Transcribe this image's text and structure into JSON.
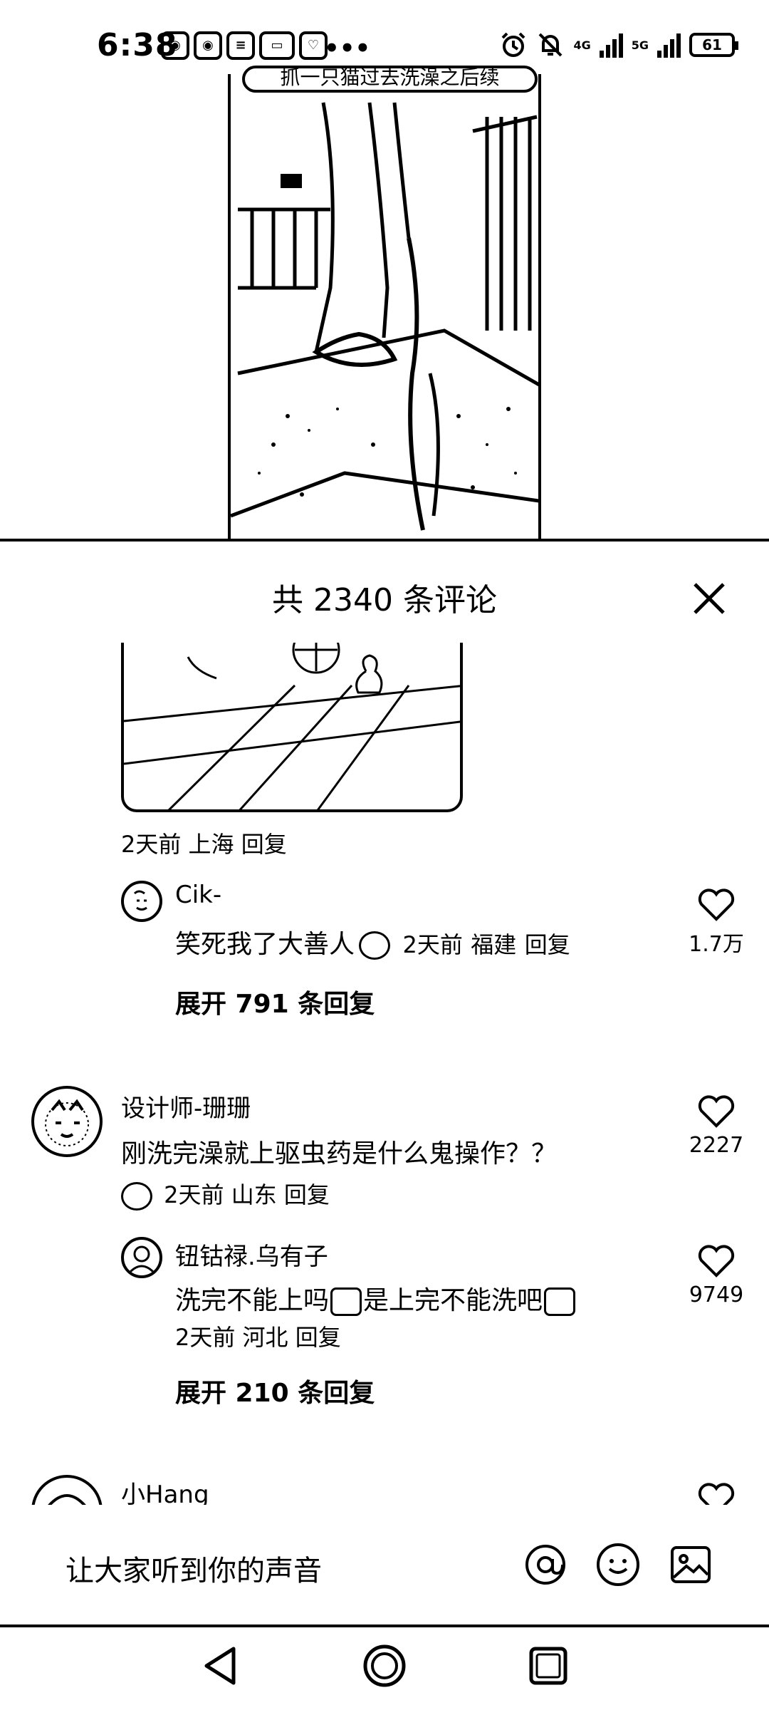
{
  "status_bar": {
    "time": "6:38",
    "notification_icons": [
      "weibo-icon",
      "weibo-icon",
      "app-icon",
      "app-icon",
      "heart-app-icon"
    ],
    "more_indicator": "•••",
    "network_1": "4G",
    "network_2": "5G",
    "battery": "61"
  },
  "video": {
    "caption": "抓一只猫过去洗澡之后续"
  },
  "comments_sheet": {
    "title": "共 2340 条评论",
    "first_comment_meta": {
      "time": "2天前",
      "location": "上海",
      "reply": "回复"
    },
    "reply_cik": {
      "username": "Cik-",
      "text": "笑死我了大善人",
      "time": "2天前",
      "location": "福建",
      "reply": "回复",
      "likes": "1.7万",
      "expand": "展开 791 条回复"
    },
    "comment_designer": {
      "username": "设计师-珊珊",
      "text": "刚洗完澡就上驱虫药是什么鬼操作？？",
      "time": "2天前",
      "location": "山东",
      "reply": "回复",
      "likes": "2227"
    },
    "reply_niu": {
      "username": "钮钴禄.乌有子",
      "text_a": "洗完不能上吗",
      "text_b": "是上完不能洗吧",
      "time": "2天前",
      "location": "河北",
      "reply": "回复",
      "likes": "9749",
      "expand": "展开 210 条回复"
    },
    "comment_xiaohang": {
      "username": "小Hang"
    }
  },
  "input_bar": {
    "placeholder": "让大家听到你的声音"
  }
}
